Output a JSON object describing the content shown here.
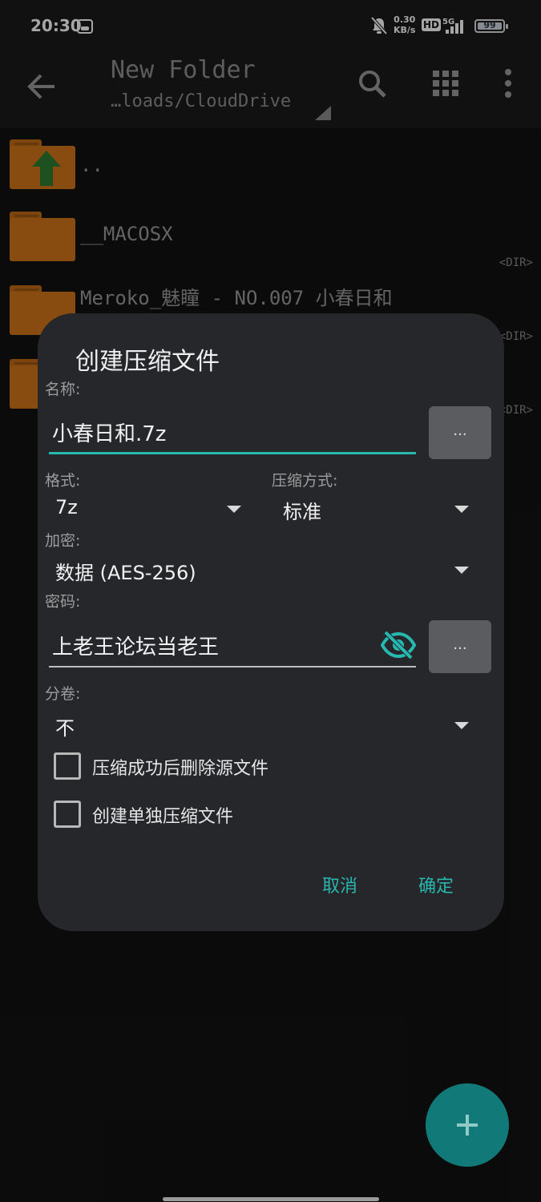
{
  "status_bar": {
    "time": "20:30",
    "speed_value": "0.30",
    "speed_unit": "KB/s",
    "hd_label": "HD",
    "network_label": "5G",
    "battery_level": "99"
  },
  "app_bar": {
    "title": "New Folder",
    "path": "…loads/CloudDrive"
  },
  "files": [
    {
      "name": "..",
      "tag": ""
    },
    {
      "name": "__MACOSX",
      "tag": "<DIR>"
    },
    {
      "name": "Meroko_魅瞳 - NO.007 小春日和",
      "tag": "<DIR>"
    },
    {
      "name": "",
      "tag": "<DIR>"
    }
  ],
  "dialog": {
    "title": "创建压缩文件",
    "name_label": "名称:",
    "name_value": "小春日和.7z",
    "browse_label": "...",
    "format_label": "格式:",
    "format_value": "7z",
    "method_label": "压缩方式:",
    "method_value": "标准",
    "encryption_label": "加密:",
    "encryption_value": "数据 (AES-256)",
    "password_label": "密码:",
    "password_value": "上老王论坛当老王",
    "password_browse_label": "...",
    "split_label": "分卷:",
    "split_value": "不",
    "delete_source_label": "压缩成功后删除源文件",
    "separate_archive_label": "创建单独压缩文件",
    "cancel_label": "取消",
    "ok_label": "确定"
  },
  "colors": {
    "accent": "#29b6ae",
    "folder": "#d3761a",
    "dialog_bg": "#26272a"
  }
}
